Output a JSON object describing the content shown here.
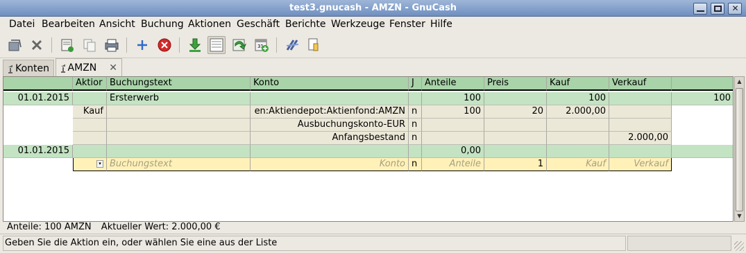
{
  "window": {
    "title": "test3.gnucash - AMZN - GnuCash"
  },
  "menu": [
    "Datei",
    "Bearbeiten",
    "Ansicht",
    "Buchung",
    "Aktionen",
    "Geschäft",
    "Berichte",
    "Werkzeuge",
    "Fenster",
    "Hilfe"
  ],
  "toolbar_icons": [
    "save-icon",
    "close-icon",
    "duplicate-icon",
    "copy-icon",
    "print-icon",
    "add-icon",
    "delete-icon",
    "enter-icon",
    "split-icon",
    "jump-icon",
    "schedule-icon",
    "transfer-icon",
    "find-icon"
  ],
  "tabs": [
    {
      "label": "Konten",
      "icon": "bank-icon"
    },
    {
      "label": "AMZN",
      "icon": "bank-icon",
      "active": true
    }
  ],
  "register": {
    "headers": [
      "",
      "Aktior",
      "Buchungstext",
      "Konto",
      "J",
      "Anteile",
      "Preis",
      "Kauf",
      "Verkauf",
      ""
    ],
    "transaction": {
      "date": "01.01.2015",
      "description": "Ersterwerb",
      "anteile": "100",
      "kauf": "100",
      "balance": "100"
    },
    "splits": [
      {
        "action": "Kauf",
        "account": "en:Aktiendepot:Aktienfond:AMZN",
        "r": "n",
        "anteile": "100",
        "preis": "20",
        "kauf": "2.000,00",
        "verkauf": ""
      },
      {
        "action": "",
        "account": "Ausbuchungskonto-EUR",
        "r": "n",
        "anteile": "",
        "preis": "",
        "kauf": "",
        "verkauf": ""
      },
      {
        "action": "",
        "account": "Anfangsbestand",
        "r": "n",
        "anteile": "",
        "preis": "",
        "kauf": "",
        "verkauf": "2.000,00"
      }
    ],
    "new_transaction": {
      "date": "01.01.2015",
      "anteile": "0,00"
    },
    "edit_row": {
      "description_placeholder": "Buchungstext",
      "account_placeholder": "Konto",
      "r": "n",
      "anteile_placeholder": "Anteile",
      "preis": "1",
      "kauf_placeholder": "Kauf",
      "verkauf_placeholder": "Verkauf"
    }
  },
  "summary": {
    "shares": "Anteile: 100 AMZN",
    "value": "Aktueller Wert: 2.000,00 €"
  },
  "status": {
    "message": "Geben Sie die Aktion ein, oder wählen Sie eine aus der Liste"
  }
}
